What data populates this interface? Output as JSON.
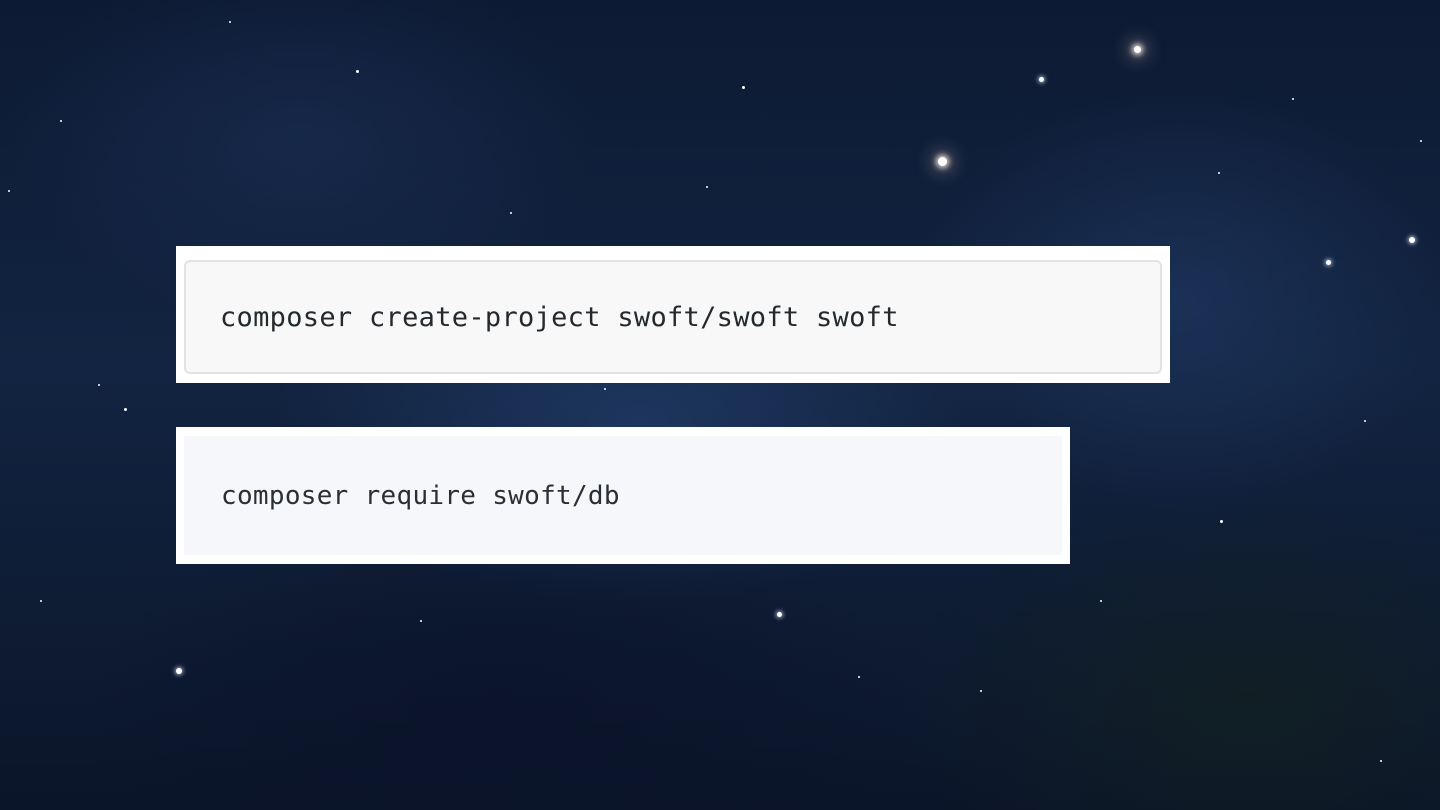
{
  "code_blocks": [
    {
      "command": "composer create-project swoft/swoft swoft"
    },
    {
      "command": "composer require swoft/db"
    }
  ],
  "colors": {
    "background": "#0d1a33",
    "panel": "#ffffff",
    "code_box_1": "#f8f8f8",
    "code_box_2": "#f5f7fa",
    "code_text": "#24292e"
  }
}
